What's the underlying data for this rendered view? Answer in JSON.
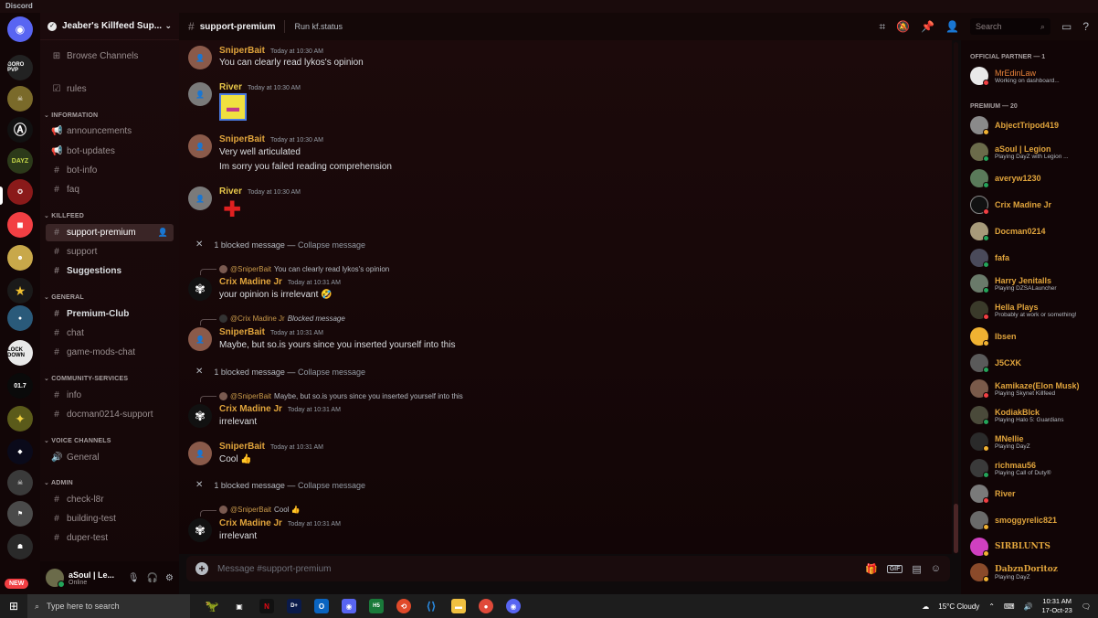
{
  "window": {
    "title": "Discord"
  },
  "server": {
    "name": "Jeaber's Killfeed Sup..."
  },
  "sidebar": {
    "browse_label": "Browse Channels",
    "rules_label": "rules",
    "categories": {
      "information": "INFORMATION",
      "killfeed": "KILLFEED",
      "general": "GENERAL",
      "community": "COMMUNITY-SERVICES",
      "voice": "VOICE CHANNELS",
      "admin": "ADMIN"
    },
    "channels": {
      "announcements": "announcements",
      "bot_updates": "bot-updates",
      "bot_info": "bot-info",
      "faq": "faq",
      "support_premium": "support-premium",
      "support": "support",
      "suggestions": "Suggestions",
      "premium_club": "Premium-Club",
      "chat": "chat",
      "game_mods_chat": "game-mods-chat",
      "info": "info",
      "docman_support": "docman0214-support",
      "general_voice": "General",
      "check_l8r": "check-l8r",
      "building_test": "building-test",
      "duper_test": "duper-test"
    }
  },
  "servers": {
    "new_badge": "NEW",
    "labels": [
      "GORO PVP",
      "DAYZ",
      "LOCK DOWN",
      "01.7"
    ]
  },
  "user_panel": {
    "name": "aSoul | Le...",
    "status": "Online"
  },
  "header": {
    "channel": "support-premium",
    "topic": "Run kf.status",
    "search_placeholder": "Search"
  },
  "messages": {
    "m1": {
      "author": "SniperBait",
      "time": "Today at 10:30 AM",
      "text": "You can clearly read lykos's opinion"
    },
    "m2": {
      "author": "River",
      "time": "Today at 10:30 AM"
    },
    "m3": {
      "author": "SniperBait",
      "time": "Today at 10:30 AM",
      "text1": "Very well articulated",
      "text2": "Im sorry you failed reading comprehension"
    },
    "m4": {
      "author": "River",
      "time": "Today at 10:30 AM"
    },
    "blocked1": {
      "text": "1 blocked message —",
      "action": "Collapse message"
    },
    "m5": {
      "reply_name": "@SniperBait",
      "reply_text": "You can clearly read lykos's opinion",
      "author": "Crix Madine Jr",
      "time": "Today at 10:31 AM",
      "text": "your opinion is irrelevant 🤣"
    },
    "m6": {
      "reply_name": "@Crix Madine Jr",
      "reply_text": "Blocked message",
      "author": "SniperBait",
      "time": "Today at 10:31 AM",
      "text": "Maybe, but so.is yours since you inserted yourself into this"
    },
    "blocked2": {
      "text": "1 blocked message —",
      "action": "Collapse message"
    },
    "m7": {
      "reply_name": "@SniperBait",
      "reply_text": "Maybe, but so.is yours since you inserted yourself into this",
      "author": "Crix Madine Jr",
      "time": "Today at 10:31 AM",
      "text": "irrelevant"
    },
    "m8": {
      "author": "SniperBait",
      "time": "Today at 10:31 AM",
      "text": "Cool 👍"
    },
    "blocked3": {
      "text": "1 blocked message —",
      "action": "Collapse message"
    },
    "m9": {
      "reply_name": "@SniperBait",
      "reply_text": "Cool 👍",
      "author": "Crix Madine Jr",
      "time": "Today at 10:31 AM",
      "text": "irrelevant"
    }
  },
  "composer": {
    "placeholder": "Message #support-premium",
    "gif_label": "GIF"
  },
  "members": {
    "partner_header": "OFFICIAL PARTNER — 1",
    "premium_header": "PREMIUM — 20",
    "list": [
      {
        "name": "MrEdinLaw",
        "activity": "Working on dashboard..."
      },
      {
        "name": "AbjectTripod419",
        "activity": ""
      },
      {
        "name": "aSoul | Legion",
        "activity": "Playing DayZ with Legion ..."
      },
      {
        "name": "averyw1230",
        "activity": ""
      },
      {
        "name": "Crix Madine Jr",
        "activity": ""
      },
      {
        "name": "Docman0214",
        "activity": ""
      },
      {
        "name": "fafa",
        "activity": ""
      },
      {
        "name": "Harry Jenitalls",
        "activity": "Playing DZSALauncher"
      },
      {
        "name": "Hella Plays",
        "activity": "Probably at work or something!"
      },
      {
        "name": "Ibsen",
        "activity": ""
      },
      {
        "name": "J5CXK",
        "activity": ""
      },
      {
        "name": "Kamikaze(Elon Musk)",
        "activity": "Playing Skynet Killfeed"
      },
      {
        "name": "KodiakBlck",
        "activity": "Playing Halo 5: Guardians"
      },
      {
        "name": "MNellie",
        "activity": "Playing DayZ"
      },
      {
        "name": "richmau56",
        "activity": "Playing Call of Duty®"
      },
      {
        "name": "River",
        "activity": ""
      },
      {
        "name": "smoggyrelic821",
        "activity": ""
      },
      {
        "name": "SIRBLUNTS",
        "activity": ""
      },
      {
        "name": "DabznDoritoz",
        "activity": "Playing DayZ"
      }
    ]
  },
  "taskbar": {
    "search_placeholder": "Type here to search",
    "weather": "15°C  Cloudy",
    "time": "10:31 AM",
    "date": "17-Oct-23"
  },
  "colors": {
    "accent": "#e0a43c",
    "online": "#23a55a",
    "dnd": "#f23f43",
    "idle": "#f0b232"
  }
}
